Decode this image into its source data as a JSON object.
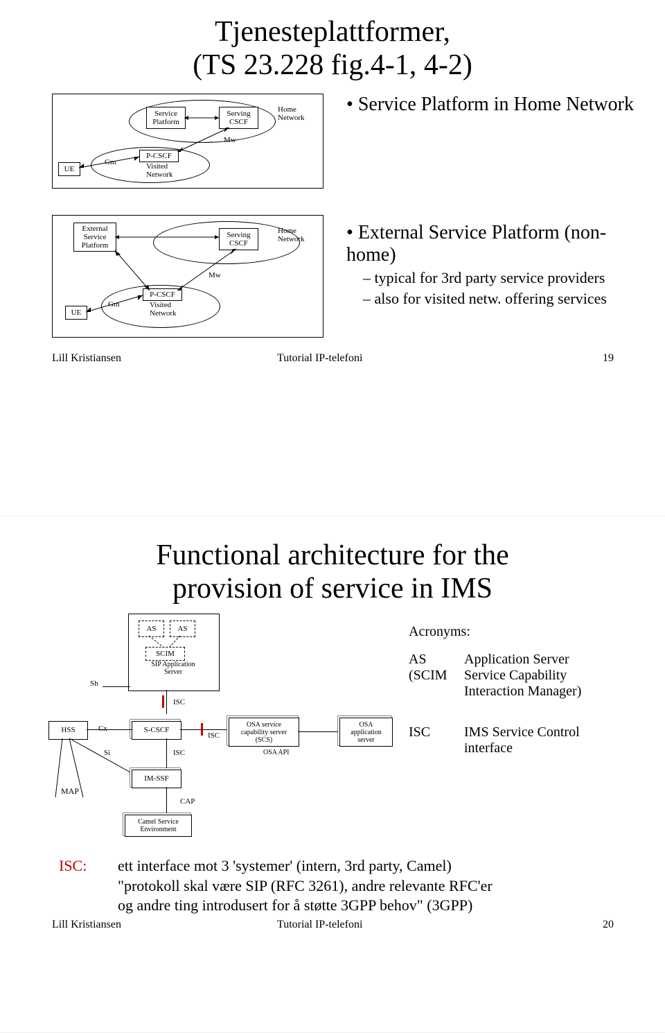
{
  "slide1": {
    "title_l1": "Tjenesteplattformer,",
    "title_l2": "(TS 23.228 fig.4-1, 4-2)",
    "bullet_top": "Service Platform in Home Network",
    "bullet_mid": "External Service Platform (non-home)",
    "sub1": "typical for 3rd party service providers",
    "sub2": "also for visited netw. offering services",
    "d1": {
      "sp": "Service\nPlatform",
      "scscf": "Serving\nCSCF",
      "home": "Home\nNetwork",
      "pcscf": "P-CSCF",
      "visited": "Visited\nNetwork",
      "ue": "UE",
      "gm": "Gm",
      "mw": "Mw"
    },
    "d2": {
      "esp": "External\nService\nPlatform",
      "scscf": "Serving\nCSCF",
      "home": "Home\nNetwork",
      "pcscf": "P-CSCF",
      "visited": "Visited\nNetwork",
      "ue": "UE",
      "gm": "Gm",
      "mw": "Mw"
    },
    "footer_left": "Lill Kristiansen",
    "footer_mid": "Tutorial IP-telefoni",
    "page": "19"
  },
  "slide2": {
    "title_l1": "Functional architecture for the",
    "title_l2": "provision of service in IMS",
    "labels": {
      "as": "AS",
      "scim": "SCIM",
      "sipas": "SIP Application\nServer",
      "scscf": "S-CSCF",
      "imssf": "IM-SSF",
      "cse": "Camel Service\nEnvironment",
      "scs": "OSA service\ncapability server\n(SCS)",
      "osaas": "OSA\napplication\nserver",
      "hss": "HSS",
      "isc": "ISC",
      "osaapi": "OSA API",
      "cap": "CAP",
      "cx": "Cx",
      "si": "Si",
      "sh": "Sh",
      "map": "MAP"
    },
    "acro_title": "Acronyms:",
    "acro": {
      "as_k": "AS",
      "as_v": "Application Server",
      "scim_k": "(SCIM",
      "scim_v": "Service Capability",
      "scim_v2": "Interaction Manager)",
      "isc_k": "ISC",
      "isc_v": "IMS Service Control",
      "isc_v2": "interface"
    },
    "isc_red": "ISC:",
    "isc_text_l1": "ett interface mot 3 'systemer' (intern, 3rd party, Camel)",
    "isc_text_l2": "\"protokoll skal være SIP (RFC 3261), andre relevante RFC'er",
    "isc_text_l3": "og andre  ting introdusert for å støtte 3GPP behov\" (3GPP)",
    "footer_left": "Lill Kristiansen",
    "footer_mid": "Tutorial IP-telefoni",
    "page": "20"
  }
}
